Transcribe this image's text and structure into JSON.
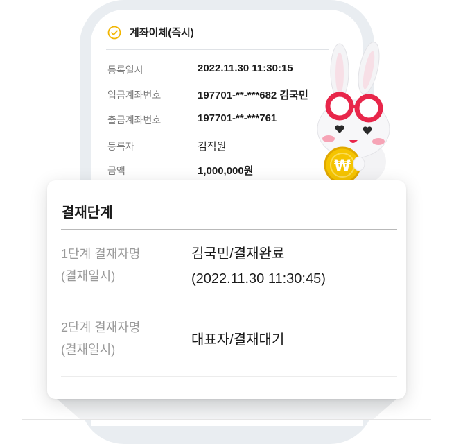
{
  "transfer": {
    "title": "계좌이체(즉시)",
    "rows": [
      {
        "label": "등록일시",
        "value": "2022.11.30 11:30:15"
      },
      {
        "label": "입금계좌번호",
        "value": "197701-**-***682 김국민"
      },
      {
        "label": "출금계좌번호",
        "value": "197701-**-***761"
      },
      {
        "label": "등록자",
        "value": "김직원"
      },
      {
        "label": "금액",
        "value": "1,000,000원"
      }
    ]
  },
  "approval": {
    "title": "결재단계",
    "stages": [
      {
        "label": "1단계 결재자명\n(결재일시)",
        "value": "김국민/결재완료\n(2022.11.30 11:30:45)"
      },
      {
        "label": "2단계 결재자명\n(결재일시)",
        "value": "대표자/결재대기"
      }
    ]
  },
  "mascot": {
    "coin_symbol": "₩"
  },
  "colors": {
    "accent_yellow": "#f7b500",
    "glasses_red": "#e8264a",
    "coin_gold": "#f5c400"
  }
}
